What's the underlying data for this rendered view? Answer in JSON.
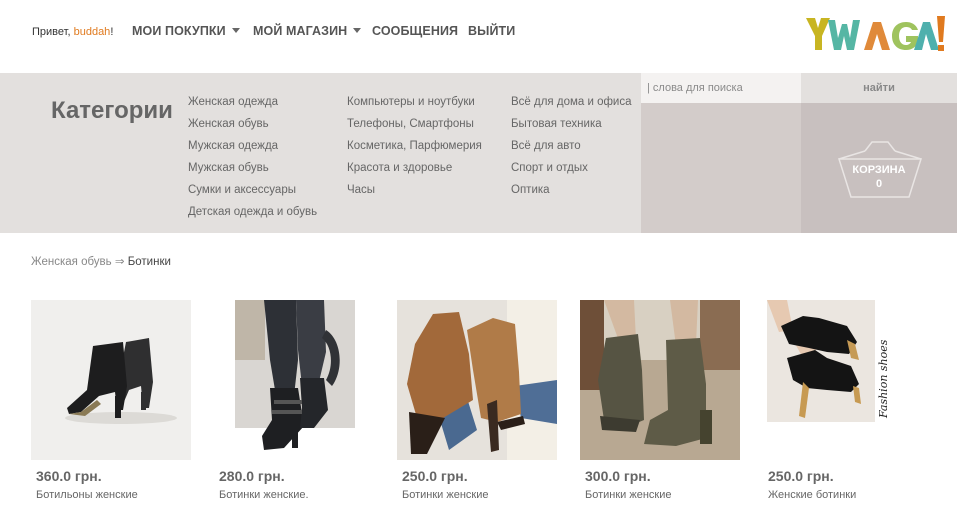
{
  "header": {
    "greeting_prefix": "Привет,",
    "user_name": "buddah",
    "greeting_suffix": "!",
    "nav": [
      {
        "label": "МОИ ПОКУПКИ"
      },
      {
        "label": "МОЙ МАГАЗИН"
      },
      {
        "label": "СООБЩЕНИЯ"
      },
      {
        "label": "ВЫЙТИ"
      }
    ],
    "logo_text": "YWAGA!",
    "logo_colors": [
      "#c8b522",
      "#55b6a4",
      "#e08a3a",
      "#9fc35e",
      "#4fb0ad",
      "#e07a1f"
    ]
  },
  "categories": {
    "title": "Категории",
    "col1": [
      "Женская одежда",
      "Женская обувь",
      "Мужская одежда",
      "Мужская обувь",
      "Сумки и аксессуары",
      "Детская одежда и обувь"
    ],
    "col2": [
      "Компьютеры и ноутбуки",
      "Телефоны, Смартфоны",
      "Косметика, Парфюмерия",
      "Красота и здоровье",
      "Часы"
    ],
    "col3": [
      "Всё для дома и офиса",
      "Бытовая техника",
      "Всё для авто",
      "Спорт и отдых",
      "Оптика"
    ]
  },
  "search": {
    "placeholder": "| слова для поиска",
    "button_label": "найти"
  },
  "cart": {
    "label": "КОРЗИНА",
    "count": "0"
  },
  "breadcrumb": {
    "parent": "Женская обувь",
    "separator": "⇒",
    "current": "Ботинки"
  },
  "products": [
    {
      "price": "360.0 грн.",
      "name": "Ботильоны женские"
    },
    {
      "price": "280.0 грн.",
      "name": "Ботинки женские."
    },
    {
      "price": "250.0 грн.",
      "name": "Ботинки женские"
    },
    {
      "price": "300.0 грн.",
      "name": "Ботинки женские"
    },
    {
      "price": "250.0 грн.",
      "name": "Женские ботинки"
    }
  ],
  "product_image_watermark": "Fashion shoes"
}
